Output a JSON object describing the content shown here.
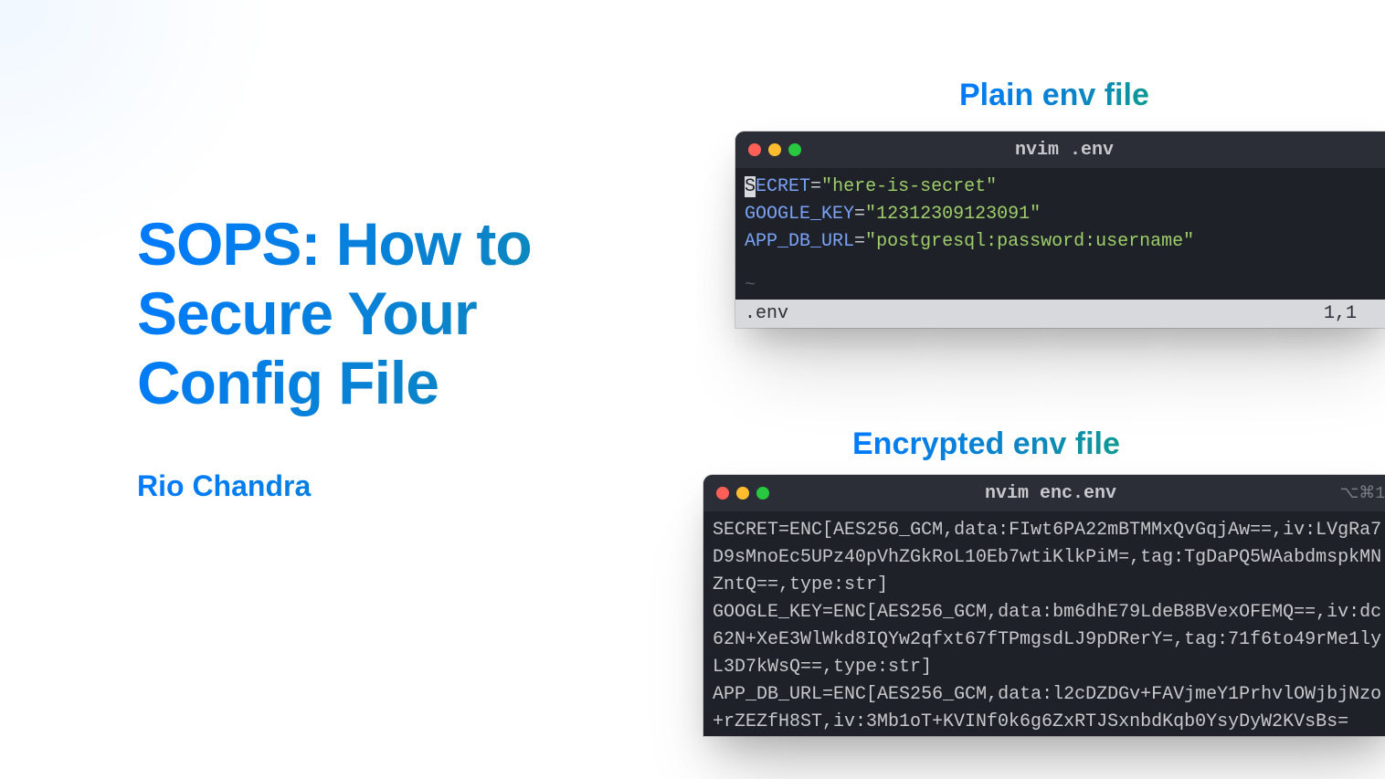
{
  "heading": {
    "title": "SOPS: How to Secure Your Config File",
    "author": "Rio Chandra"
  },
  "labels": {
    "plain": "Plain env file",
    "encrypted": "Encrypted env file"
  },
  "plain_window": {
    "title": "nvim .env",
    "env": {
      "SECRET": "here-is-secret",
      "GOOGLE_KEY": "12312309123091",
      "APP_DB_URL": "postgresql:password:username"
    },
    "status_file": ".env",
    "status_pos": "1,1"
  },
  "encrypted_window": {
    "title": "nvim enc.env",
    "corner_meta": "⌥⌘1",
    "env": {
      "SECRET": "ENC[AES256_GCM,data:FIwt6PA22mBTMMxQvGqjAw==,iv:LVgRa7D9sMnoEc5UPz40pVhZGkRoL10Eb7wtiKlkPiM=,tag:TgDaPQ5WAabdmspkMNZntQ==,type:str]",
      "GOOGLE_KEY": "ENC[AES256_GCM,data:bm6dhE79LdeB8BVexOFEMQ==,iv:dc62N+XeE3WlWkd8IQYw2qfxt67fTPmgsdLJ9pDRerY=,tag:71f6to49rMe1lyL3D7kWsQ==,type:str]",
      "APP_DB_URL": "ENC[AES256_GCM,data:l2cDZDGv+FAVjmeY1PrhvlOWjbjNzo+rZEZfH8ST,iv:3Mb1oT+KVINf0k6g6ZxRTJSxnbdKqb0YsyDyW2KVsBs="
    }
  }
}
